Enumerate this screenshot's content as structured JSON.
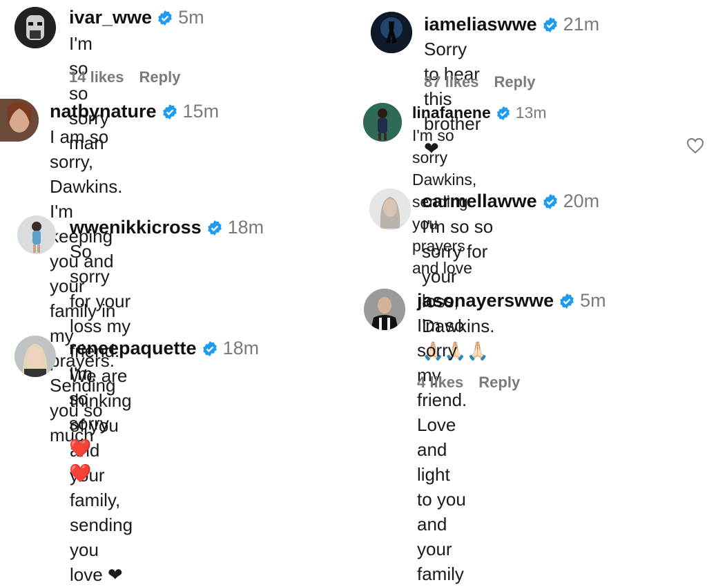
{
  "comments": [
    {
      "user": "ivar_wwe",
      "time": "5m",
      "text": "I'm so so sorry man",
      "likes": "14 likes",
      "reply": "Reply"
    },
    {
      "user": "natbynature",
      "time": "15m",
      "text": "I am so sorry, Dawkins. I'm\nkeeping you and your family in my\nprayers. Sending you so much"
    },
    {
      "user": "wwenikkicross",
      "time": "18m",
      "text": "So sorry for your loss my friend.\nWe are thinking of you and your\nfamily, sending you love ❤"
    },
    {
      "user": "reneepaquette",
      "time": "18m",
      "text": "I'm so sorry ❤️❤️"
    },
    {
      "user": "iameliaswwe",
      "time": "21m",
      "text": "Sorry to hear this brother ❤",
      "likes": "87 likes",
      "reply": "Reply"
    },
    {
      "user": "linafanene",
      "time": "13m",
      "text": "I'm so sorry Dawkins, sending you\nprayers and love"
    },
    {
      "user": "carmellawwe",
      "time": "20m",
      "text": "I'm so so sorry for your loss,\nDawkins. 🙏🏻🙏🏻🙏🏻"
    },
    {
      "user": "jasonayerswwe",
      "time": "5m",
      "text": "I'm so sorry my friend. Love and\nlight to you and your family",
      "likes": "4 likes",
      "reply": "Reply"
    }
  ],
  "icons": {
    "verified": "verified-badge-icon",
    "like": "heart-outline-icon"
  },
  "colors": {
    "verified": "#1d9bf0",
    "secondary_text": "#7a7a7a"
  }
}
